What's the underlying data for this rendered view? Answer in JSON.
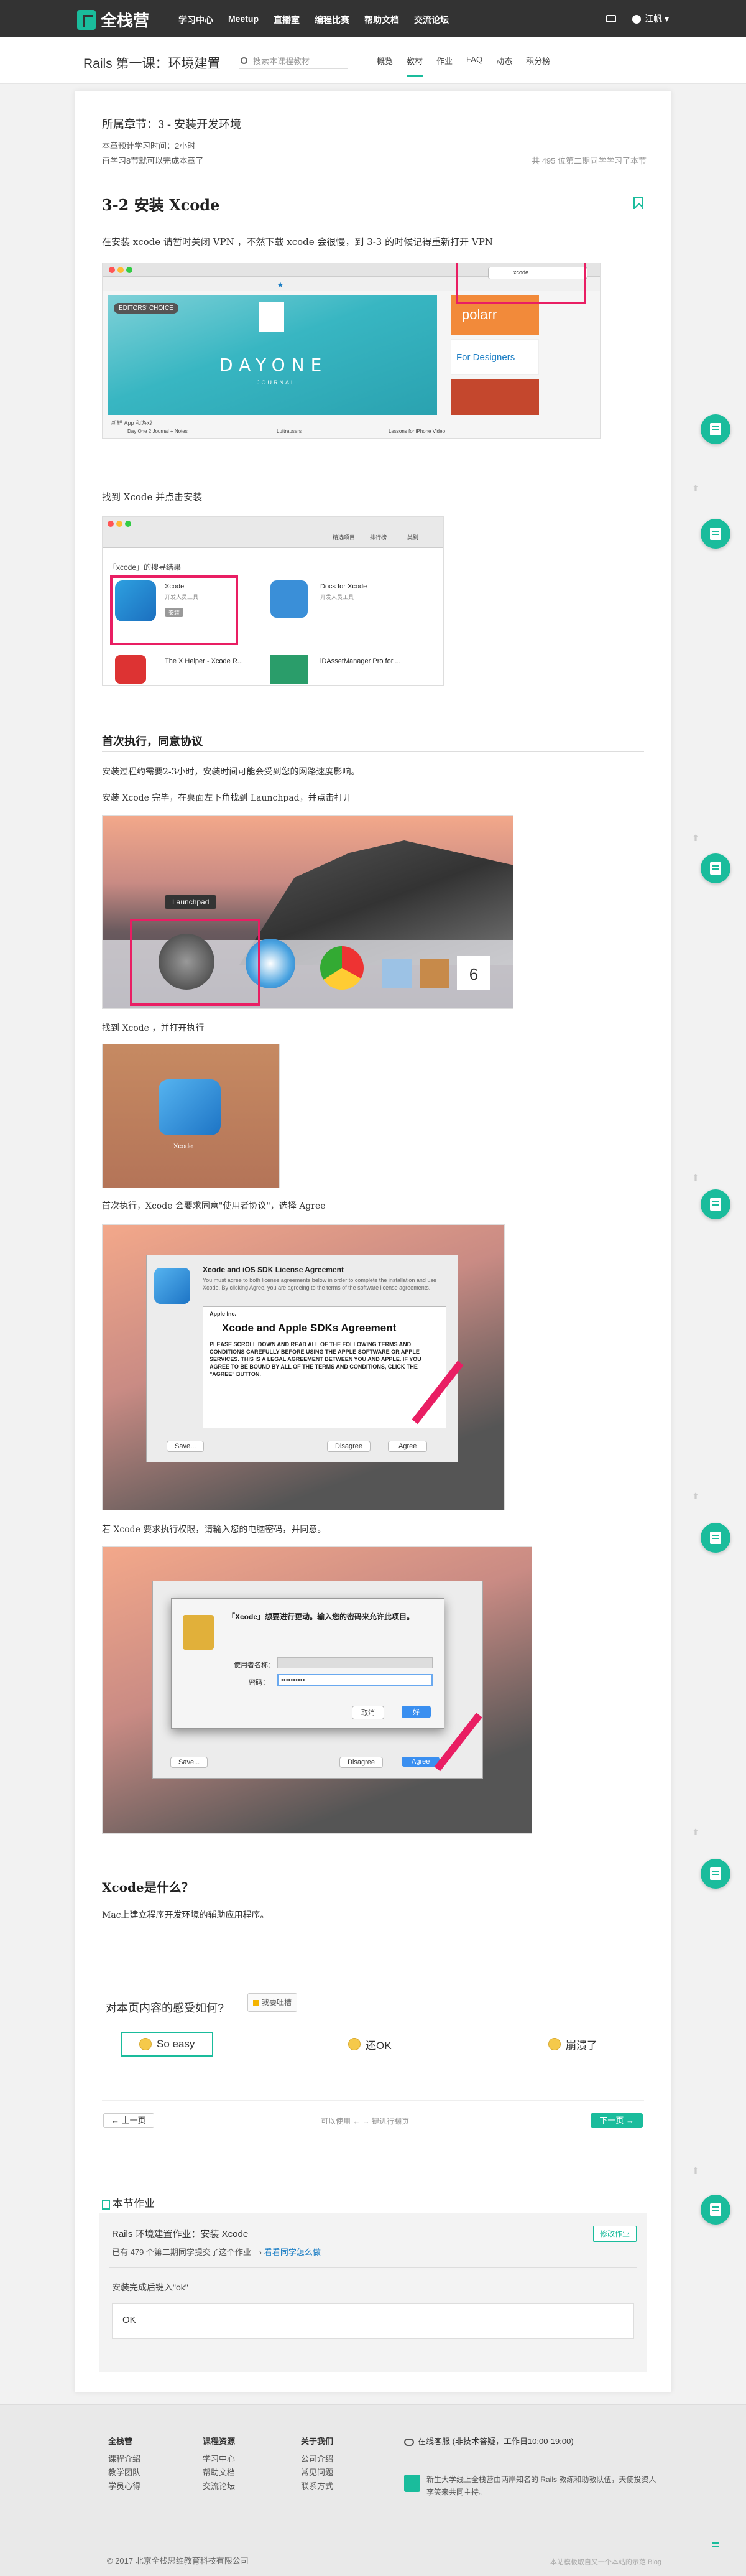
{
  "topbar": {
    "brand": "全栈营",
    "nav": [
      "学习中心",
      "Meetup",
      "直播室",
      "编程比赛",
      "帮助文档",
      "交流论坛"
    ],
    "user": "江帆 ▾"
  },
  "course": {
    "title": "Rails 第一课：环境建置",
    "search_placeholder": "搜索本课程教材",
    "tabs": [
      "概览",
      "教材",
      "作业",
      "FAQ",
      "动态",
      "积分榜"
    ],
    "active_tab": "教材"
  },
  "chapter": {
    "title": "所属章节：3 - 安装开发环境",
    "time": "本章预计学习时间：2小时",
    "done": "再学习8节就可以完成本章了",
    "progress": "共 495 位第二期同学学习了本节"
  },
  "lesson": {
    "title": "3-2 安装 Xcode",
    "p1": "在安装 xcode 请暂时关闭 VPN ，不然下载 xcode 会很慢，到 3-3 的时候记得重新打开 VPN",
    "p2": "找到 Xcode 并点击安装",
    "h2": "首次执行，同意协议",
    "p3": "安装过程约需要2-3小时，安装时间可能会受到您的网路速度影响。",
    "p4": "安装 Xcode 完毕，在桌面左下角找到 Launchpad，并点击打开",
    "p5": "找到 Xcode ，并打开执行",
    "p6": "首次执行，Xcode 会要求同意\"使用者协议\"，选择 Agree",
    "p7": "若 Xcode 要求执行权限，请输入您的电脑密码，并同意。",
    "h3": "Xcode是什么？",
    "p8": "Mac上建立程序开发环境的辅助应用程序。"
  },
  "screens": {
    "appstore": {
      "badge": "EDITORS' CHOICE",
      "hero": "DAYONE",
      "hero_sub": "JOURNAL",
      "search": "xcode",
      "polarr": "polarr",
      "designers": "For Designers",
      "app1": "Day One 2 Journal + Notes",
      "app2": "Luftrausers",
      "app3": "Lessons for iPhone Video",
      "section": "新鲜 App 和游戏"
    },
    "search_result": {
      "header": "「xcode」的搜寻结果",
      "tabs": [
        "精选项目",
        "排行榜",
        "类别"
      ],
      "r1": "Xcode",
      "r1_sub": "开发人员工具",
      "r1_btn": "安装",
      "r2": "Docs for Xcode",
      "r2_sub": "开发人员工具",
      "r3": "The X Helper - Xcode R...",
      "r4": "iDAssetManager Pro for ..."
    },
    "launchpad": {
      "label": "Launchpad",
      "cal": "6"
    },
    "xcode_icon": {
      "label": "Xcode"
    },
    "license": {
      "title": "Xcode and iOS SDK License Agreement",
      "intro": "You must agree to both license agreements below in order to complete the installation and use Xcode. By clicking Agree, you are agreeing to the terms of the software license agreements.",
      "company": "Apple Inc.",
      "heading": "Xcode and Apple SDKs Agreement",
      "body": "PLEASE SCROLL DOWN AND READ ALL OF THE FOLLOWING TERMS AND CONDITIONS CAREFULLY BEFORE USING THE APPLE SOFTWARE OR APPLE SERVICES. THIS IS A LEGAL AGREEMENT BETWEEN YOU AND APPLE. IF YOU AGREE TO BE BOUND BY ALL OF THE TERMS AND CONDITIONS, CLICK THE \"AGREE\" BUTTON.",
      "save": "Save...",
      "disagree": "Disagree",
      "agree": "Agree"
    },
    "auth": {
      "title": "「Xcode」想要进行更动。输入您的密码来允许此项目。",
      "user_label": "使用者名称：",
      "pass_label": "密码：",
      "pass_value": "••••••••••",
      "cancel": "取消",
      "ok": "好",
      "save": "Save...",
      "disagree": "Disagree",
      "agree": "Agree"
    }
  },
  "feedback": {
    "question": "对本页内容的感受如何?",
    "report": "我要吐槽",
    "options": [
      "So easy",
      "还OK",
      "崩溃了"
    ]
  },
  "pager": {
    "prev": "上一页",
    "hint": "可以使用 ← → 键进行翻页",
    "next": "下一页"
  },
  "homework": {
    "section": "本节作业",
    "name": "Rails 环境建置作业：安装 Xcode",
    "stat": "已有 479 个第二期同学提交了这个作业",
    "stat_link": "看看同学怎么做",
    "edit": "修改作业",
    "prompt": "安装完成后键入\"ok\"",
    "answer": "OK"
  },
  "footer": {
    "col1": {
      "head": "全栈营",
      "items": [
        "课程介绍",
        "教学团队",
        "学员心得"
      ]
    },
    "col2": {
      "head": "课程资源",
      "items": [
        "学习中心",
        "帮助文档",
        "交流论坛"
      ]
    },
    "col3": {
      "head": "关于我们",
      "items": [
        "公司介绍",
        "常见问题",
        "联系方式"
      ]
    },
    "service": "在线客服 (非技术答疑，工作日10:00-19:00)",
    "intro": "新生大学线上全栈营由两岸知名的 Rails 教练和助教队伍，天使投资人李笑来共同主持。",
    "copyright": "© 2017 北京全栈思维教育科技有限公司",
    "right": "本站模板取自又一个本站的示范 Blog"
  },
  "colors": {
    "accent": "#1abc9c",
    "highlight": "#e91e63",
    "topbar": "#333333"
  }
}
